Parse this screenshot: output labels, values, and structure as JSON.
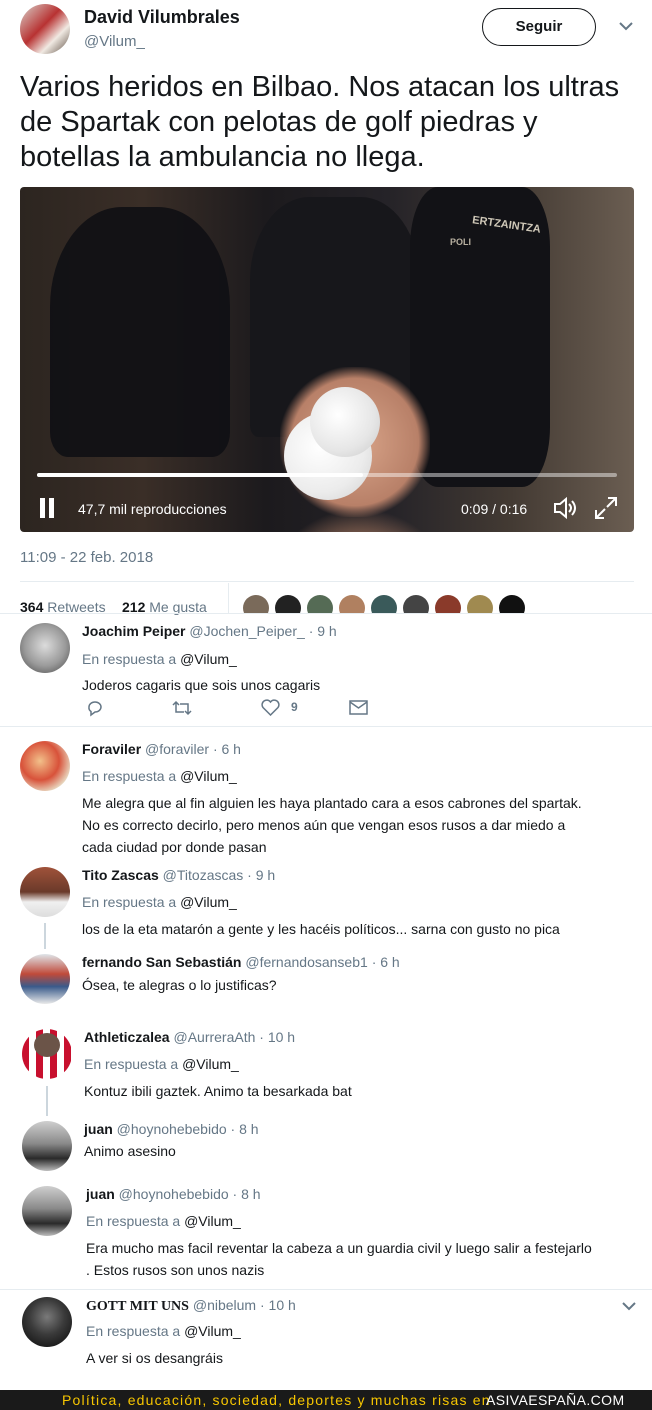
{
  "author": {
    "name": "David Vilumbrales",
    "handle": "@Vilum_"
  },
  "follow_label": "Seguir",
  "tweet_text": "Varios heridos en Bilbao. Nos atacan los ultras de Spartak con pelotas de golf piedras y botellas la ambulancia no llega.",
  "video": {
    "views": "47,7 mil reproducciones",
    "time": "0:09 / 0:16",
    "progress": 0.5625,
    "overlay_text_1": "ERTZAINTZA",
    "overlay_text_2": "POLI"
  },
  "timestamp": "11:09 - 22 feb. 2018",
  "stats": {
    "retweets_count": "364",
    "retweets_label": "Retweets",
    "likes_count": "212",
    "likes_label": "Me gusta"
  },
  "replies": [
    {
      "name": "Joachim Peiper",
      "handle": "@Jochen_Peiper_",
      "time": "· 9 h",
      "in_reply_prefix": "En respuesta a",
      "in_reply_to": "@Vilum_",
      "text": "Joderos cagaris que sois unos cagaris",
      "like_count": "9"
    },
    {
      "name": "Foraviler",
      "handle": "@foraviler",
      "time": "· 6 h",
      "in_reply_prefix": "En respuesta a",
      "in_reply_to": "@Vilum_",
      "text_lines": [
        "Me alegra que al fin alguien les haya plantado cara a esos cabrones del spartak.",
        "No es correcto decirlo, pero menos aún que vengan esos rusos a dar miedo a",
        "cada ciudad por donde pasan"
      ]
    },
    {
      "name": "Tito Zascas",
      "handle": "@Titozascas",
      "time": "· 9 h",
      "in_reply_prefix": "En respuesta a",
      "in_reply_to": "@Vilum_",
      "text": "los de la eta matarón a gente y les hacéis políticos... sarna con gusto no pica"
    },
    {
      "name": "fernando San Sebastián",
      "handle": "@fernandosanseb1",
      "time": "· 6 h",
      "text": "Ósea, te alegras o lo justificas?"
    },
    {
      "name": "Athleticzalea",
      "handle": "@AurreraAth",
      "time": "· 10 h",
      "in_reply_prefix": "En respuesta a",
      "in_reply_to": "@Vilum_",
      "text": "Kontuz ibili gaztek. Animo ta besarkada bat"
    },
    {
      "name": "juan",
      "handle": "@hoynohebebido",
      "time": "· 8 h",
      "text": "Animo asesino"
    },
    {
      "name": "juan",
      "handle": "@hoynohebebido",
      "time": "· 8 h",
      "in_reply_prefix": "En respuesta a",
      "in_reply_to": "@Vilum_",
      "text_lines": [
        "Era mucho mas facil reventar la cabeza a un guardia civil y luego salir a festejarlo",
        ". Estos rusos son unos nazis"
      ]
    },
    {
      "name": "GOTT MIT UNS",
      "handle": "@nibelum",
      "time": "· 10 h",
      "in_reply_prefix": "En respuesta a",
      "in_reply_to": "@Vilum_",
      "text": "A ver si os desangráis"
    }
  ],
  "footer": {
    "text": "Política, educación, sociedad, deportes y muchas risas en",
    "brand": "ASIVAESPAÑA.COM"
  },
  "colors": {
    "accent": "#1da1f2",
    "gray": "#657786",
    "footer_bg": "#1a1a1a",
    "footer_text": "#f7c600"
  }
}
